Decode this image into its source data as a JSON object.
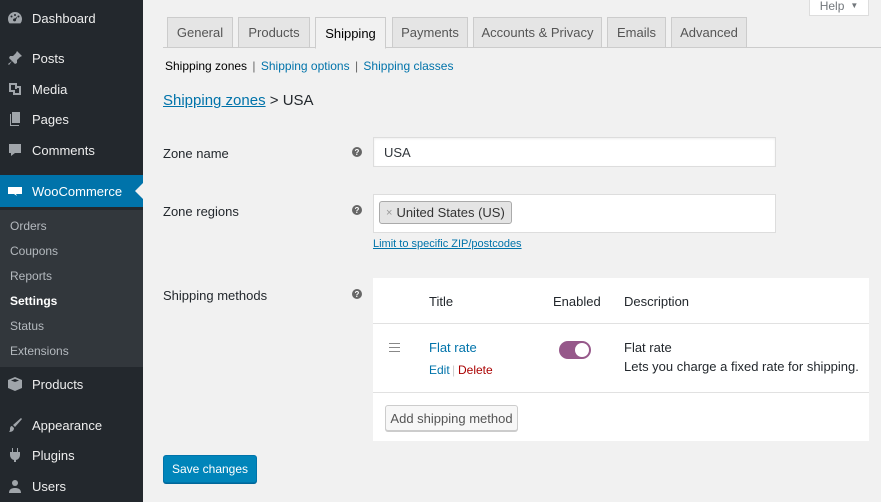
{
  "sidebar": {
    "items": [
      {
        "label": "Dashboard",
        "icon": "dashboard-icon"
      },
      {
        "label": "Posts",
        "icon": "pin-icon"
      },
      {
        "label": "Media",
        "icon": "media-icon"
      },
      {
        "label": "Pages",
        "icon": "pages-icon"
      },
      {
        "label": "Comments",
        "icon": "comment-icon"
      },
      {
        "label": "WooCommerce",
        "icon": "woocommerce-icon"
      },
      {
        "label": "Products",
        "icon": "box-icon"
      },
      {
        "label": "Appearance",
        "icon": "paintbrush-icon"
      },
      {
        "label": "Plugins",
        "icon": "plugin-icon"
      },
      {
        "label": "Users",
        "icon": "users-icon"
      }
    ],
    "submenu": [
      "Orders",
      "Coupons",
      "Reports",
      "Settings",
      "Status",
      "Extensions"
    ],
    "active_color": "#0073aa"
  },
  "help": {
    "label": "Help"
  },
  "tabs": [
    "General",
    "Products",
    "Shipping",
    "Payments",
    "Accounts & Privacy",
    "Emails",
    "Advanced"
  ],
  "subnav": {
    "current": "Shipping zones",
    "options": "Shipping options",
    "classes": "Shipping classes",
    "separator": "|"
  },
  "breadcrumb": {
    "link": "Shipping zones",
    "sep": ">",
    "current": "USA"
  },
  "form": {
    "zone_name_label": "Zone name",
    "zone_name_value": "USA",
    "zone_regions_label": "Zone regions",
    "region_tag": "United States (US)",
    "region_remove": "×",
    "limit_link": "Limit to specific ZIP/postcodes",
    "shipping_methods_label": "Shipping methods",
    "help_glyph": "?"
  },
  "methods_table": {
    "headers": {
      "title": "Title",
      "enabled": "Enabled",
      "description": "Description"
    },
    "rows": [
      {
        "title": "Flat rate",
        "edit": "Edit",
        "delete": "Delete",
        "sep": "|",
        "enabled": true,
        "desc_title": "Flat rate",
        "desc_text": "Lets you charge a fixed rate for shipping."
      }
    ],
    "add_button": "Add shipping method",
    "toggle_color": "#96588a"
  },
  "save_button": "Save changes"
}
